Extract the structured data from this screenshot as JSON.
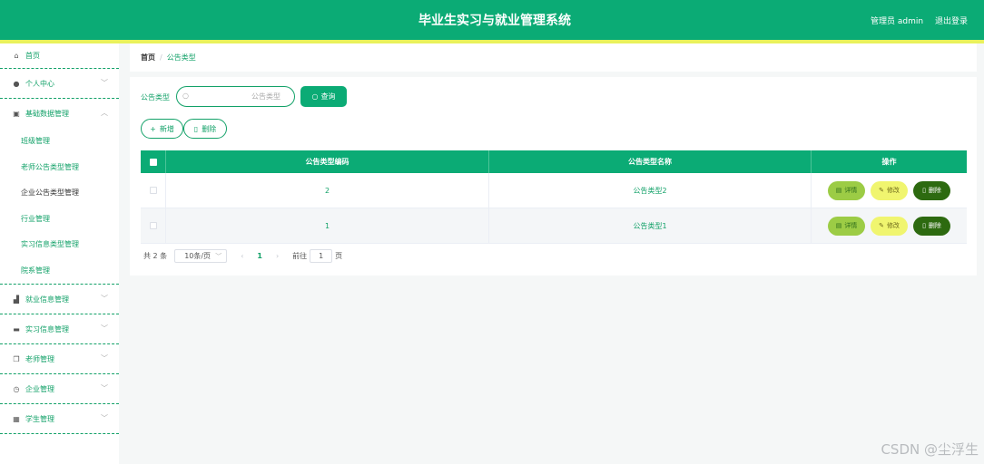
{
  "header": {
    "title": "毕业生实习与就业管理系统",
    "user_label": "管理员 admin",
    "logout_label": "退出登录"
  },
  "sidebar": {
    "home": "首页",
    "personal": "个人中心",
    "basic": "基础数据管理",
    "basic_items": [
      "班级管理",
      "老师公告类型管理",
      "企业公告类型管理",
      "行业管理",
      "实习信息类型管理",
      "院系管理"
    ],
    "menus": [
      "就业信息管理",
      "实习信息管理",
      "老师管理",
      "企业管理",
      "学生管理"
    ]
  },
  "breadcrumb": {
    "home": "首页",
    "separator": "/",
    "current": "公告类型"
  },
  "search": {
    "label": "公告类型",
    "placeholder": "公告类型",
    "button": "查询"
  },
  "toolbar": {
    "add": "新增",
    "delete": "删除"
  },
  "table": {
    "headers": [
      "公告类型编码",
      "公告类型名称",
      "操作"
    ],
    "rows": [
      {
        "code": "2",
        "name": "公告类型2"
      },
      {
        "code": "1",
        "name": "公告类型1"
      }
    ],
    "actions": {
      "detail": "详情",
      "edit": "修改",
      "delete": "删除"
    }
  },
  "pager": {
    "total": "共 2 条",
    "page_size": "10条/页",
    "current_page": "1",
    "goto_prefix": "前往",
    "goto_value": "1",
    "goto_suffix": "页"
  },
  "watermark": "CSDN @尘浮生",
  "colors": {
    "primary": "#0bab75",
    "accent_line": "#e9f25c",
    "detail_btn": "#9ccc45",
    "edit_btn": "#f0f56f",
    "delete_btn": "#2d6a10"
  }
}
